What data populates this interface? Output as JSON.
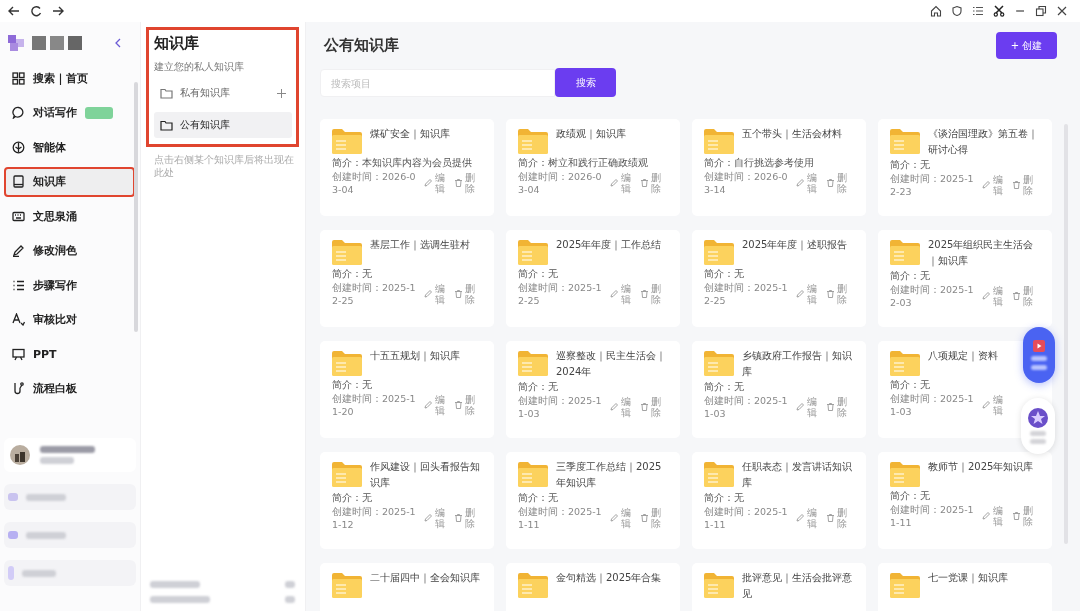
{
  "sidebar": {
    "items": [
      {
        "label": "搜索｜首页",
        "kind": "grid",
        "selected": false,
        "highlighted": false,
        "badge": false
      },
      {
        "label": "对话写作",
        "kind": "chat",
        "selected": false,
        "highlighted": false,
        "badge": true
      },
      {
        "label": "智能体",
        "kind": "agent",
        "selected": false,
        "highlighted": false,
        "badge": false
      },
      {
        "label": "知识库",
        "kind": "book",
        "selected": true,
        "highlighted": true,
        "badge": false
      },
      {
        "label": "文思泉涌",
        "kind": "keyboard",
        "selected": false,
        "highlighted": false,
        "badge": false
      },
      {
        "label": "修改润色",
        "kind": "pen",
        "selected": false,
        "highlighted": false,
        "badge": false
      },
      {
        "label": "步骤写作",
        "kind": "list",
        "selected": false,
        "highlighted": false,
        "badge": false
      },
      {
        "label": "审核比对",
        "kind": "text",
        "selected": false,
        "highlighted": false,
        "badge": false
      },
      {
        "label": "PPT",
        "kind": "ppt",
        "selected": false,
        "highlighted": false,
        "badge": false
      },
      {
        "label": "流程白板",
        "kind": "flow",
        "selected": false,
        "highlighted": false,
        "badge": false
      }
    ]
  },
  "library_panel": {
    "title": "知识库",
    "subtitle": "建立您的私人知识库",
    "highlighted": true,
    "folders": [
      {
        "label": "私有知识库",
        "selected": false,
        "add": true
      },
      {
        "label": "公有知识库",
        "selected": true,
        "add": false
      }
    ],
    "hint": "点击右侧某个知识库后将出现在此处"
  },
  "main": {
    "title": "公有知识库",
    "create_button": "+ 创建",
    "search": {
      "placeholder": "搜索项目",
      "button": "搜索"
    },
    "cards": [
      {
        "title": "煤矿安全｜知识库",
        "desc": "简介：本知识库内容为会员提供",
        "created": "创建时间：2026-03-04",
        "edit": "编辑",
        "delete": "删除"
      },
      {
        "title": "政绩观｜知识库",
        "desc": "简介：树立和践行正确政绩观",
        "created": "创建时间：2026-03-04",
        "edit": "编辑",
        "delete": "删除"
      },
      {
        "title": "五个带头｜生活会材料",
        "desc": "简介：自行挑选参考使用",
        "created": "创建时间：2026-03-14",
        "edit": "编辑",
        "delete": "删除"
      },
      {
        "title": "《谈治国理政》第五卷｜研讨心得",
        "desc": "简介：无",
        "created": "创建时间：2025-12-23",
        "edit": "编辑",
        "delete": "删除"
      },
      {
        "title": "基层工作｜选调生驻村",
        "desc": "简介：无",
        "created": "创建时间：2025-12-25",
        "edit": "编辑",
        "delete": "删除"
      },
      {
        "title": "2025年年度｜工作总结",
        "desc": "简介：无",
        "created": "创建时间：2025-12-25",
        "edit": "编辑",
        "delete": "删除"
      },
      {
        "title": "2025年年度｜述职报告",
        "desc": "简介：无",
        "created": "创建时间：2025-12-25",
        "edit": "编辑",
        "delete": "删除"
      },
      {
        "title": "2025年组织民主生活会｜知识库",
        "desc": "简介：无",
        "created": "创建时间：2025-12-03",
        "edit": "编辑",
        "delete": "删除"
      },
      {
        "title": "十五五规划｜知识库",
        "desc": "简介：无",
        "created": "创建时间：2025-11-20",
        "edit": "编辑",
        "delete": "删除"
      },
      {
        "title": "巡察整改｜民主生活会｜2024年",
        "desc": "简介：无",
        "created": "创建时间：2025-11-03",
        "edit": "编辑",
        "delete": "删除"
      },
      {
        "title": "乡镇政府工作报告｜知识库",
        "desc": "简介：无",
        "created": "创建时间：2025-11-03",
        "edit": "编辑",
        "delete": "删除"
      },
      {
        "title": "八项规定｜资料",
        "desc": "简介：无",
        "created": "创建时间：2025-11-03",
        "edit": "编辑"
      },
      {
        "title": "作风建设｜回头看报告知识库",
        "desc": "简介：无",
        "created": "创建时间：2025-11-12",
        "edit": "编辑",
        "delete": "删除"
      },
      {
        "title": "三季度工作总结｜2025年知识库",
        "desc": "简介：无",
        "created": "创建时间：2025-11-11",
        "edit": "编辑",
        "delete": "删除"
      },
      {
        "title": "任职表态｜发言讲话知识库",
        "desc": "简介：无",
        "created": "创建时间：2025-11-11",
        "edit": "编辑",
        "delete": "删除"
      },
      {
        "title": "教师节｜2025年知识库",
        "desc": "简介：无",
        "created": "创建时间：2025-11-11",
        "edit": "编辑",
        "delete": "删除"
      },
      {
        "title": "二十届四中｜全会知识库"
      },
      {
        "title": "金句精选｜2025年合集"
      },
      {
        "title": "批评意见｜生活会批评意见"
      },
      {
        "title": "七一党课｜知识库"
      }
    ]
  }
}
